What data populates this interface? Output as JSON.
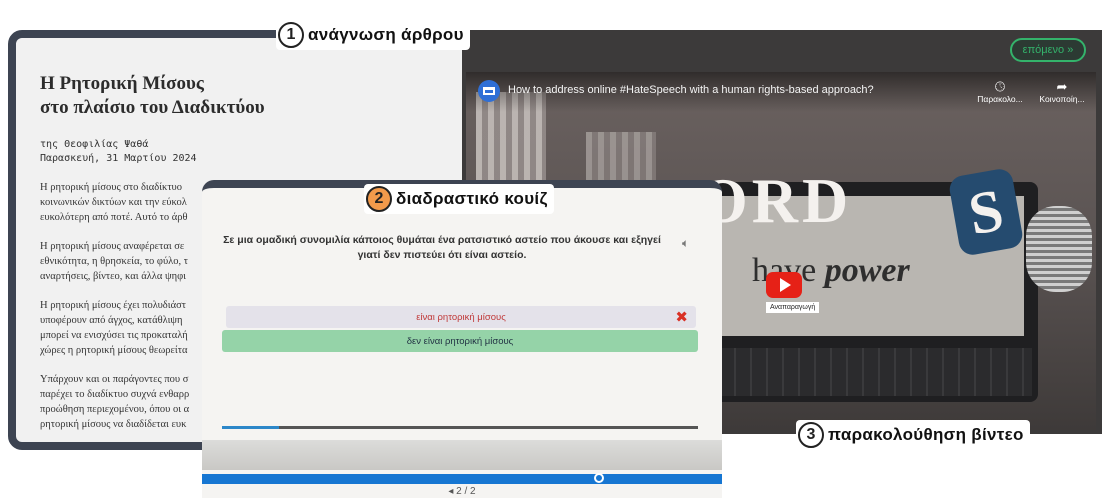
{
  "labels": {
    "article": {
      "number": "1",
      "text": "ανάγνωση άρθρου"
    },
    "quiz": {
      "number": "2",
      "text": "διαδραστικό κουίζ"
    },
    "video": {
      "number": "3",
      "text": "παρακολούθηση βίντεο"
    }
  },
  "article": {
    "title_line1": "Η Ρητορική Μίσους",
    "title_line2": "στο πλαίσιο του Διαδικτύου",
    "author": "της Θεοφιλίας Ψαθά",
    "date": "Παρασκευή, 31 Μαρτίου 2024",
    "paragraphs": [
      [
        "Η ρητορική μίσους στο διαδίκτυο",
        "κοινωνικών δικτύων και την εύκολ",
        "ευκολότερη από ποτέ. Αυτό το άρθ"
      ],
      [
        "Η ρητορική μίσους αναφέρεται σε",
        "εθνικότητα, η θρησκεία, το φύλο, τ",
        "αναρτήσεις, βίντεο, και άλλα ψηφι"
      ],
      [
        "Η ρητορική μίσους έχει πολυδιάστ",
        "υποφέρουν από άγχος, κατάθλιψη",
        "μπορεί να ενισχύσει τις προκαταλή",
        "χώρες η ρητορική μίσους θεωρείτα"
      ],
      [
        "Υπάρχουν και οι παράγοντες που σ",
        "παρέχει το διαδίκτυο συχνά ενθαρρ",
        "προώθηση περιεχομένου, όπου οι α",
        "ρητορική μίσους να διαδίδεται ευκ"
      ]
    ]
  },
  "video": {
    "title": "How to address online #HateSpeech with a human rights-based approach?",
    "watch_later": "Παρακολο...",
    "share": "Κοινοποίη...",
    "next_button": "επόμενο »",
    "scene_letters": "ORD",
    "scene_letter_s": "S",
    "scene_text_plain": "have ",
    "scene_text_bold": "power",
    "play_tooltip": "Αναπαραγωγή"
  },
  "quiz": {
    "question": "Σε μια ομαδική συνομιλία κάποιος θυμάται ένα ρατσιστικό αστείο που άκουσε και εξηγεί γιατί δεν πιστεύει ότι είναι αστείο.",
    "answers": [
      {
        "label": "είναι ρητορική μίσους",
        "state": "wrong"
      },
      {
        "label": "δεν είναι ρητορική μίσους",
        "state": "correct"
      }
    ],
    "progress": 0.12,
    "pager": "◂ 2 / 2"
  },
  "colors": {
    "panel_border": "#3d4452",
    "next_green": "#34b36b",
    "correct_green": "#95d3a8",
    "wrong_red": "#d93025",
    "progress_blue": "#2c87c9",
    "footer_blue": "#1676d2",
    "label_orange": "#f29a4b"
  },
  "icons": {
    "speaker": "speaker-icon",
    "wrong": "x-mark-icon",
    "clock": "clock-icon",
    "share": "share-icon",
    "play": "play-icon"
  }
}
